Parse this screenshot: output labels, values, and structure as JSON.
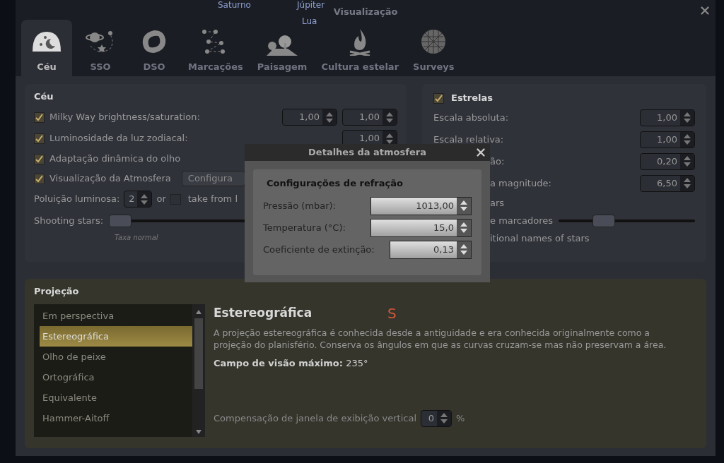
{
  "sky_labels": [
    {
      "text": "Saturno"
    },
    {
      "text": "Júpiter"
    },
    {
      "text": "Lua"
    }
  ],
  "window": {
    "title": "Visualização"
  },
  "tabs": [
    {
      "label": "Céu",
      "selected": true
    },
    {
      "label": "SSO",
      "selected": false
    },
    {
      "label": "DSO",
      "selected": false
    },
    {
      "label": "Marcações",
      "selected": false
    },
    {
      "label": "Paisagem",
      "selected": false
    },
    {
      "label": "Cultura estelar",
      "selected": false
    },
    {
      "label": "Surveys",
      "selected": false
    }
  ],
  "sky_group": {
    "title": "Céu",
    "rows": [
      {
        "kind": "check_spin",
        "label": "Milky Way brightness/saturation:",
        "checked": true,
        "values": [
          "1,00",
          "1,00"
        ]
      },
      {
        "kind": "check_spin",
        "label": "Luminosidade da luz zodiacal:",
        "checked": true,
        "values": [
          "1,00"
        ]
      },
      {
        "kind": "check",
        "label": "Adaptação dinâmica do olho",
        "checked": true
      },
      {
        "kind": "check_button",
        "label": "Visualização da Atmosfera",
        "checked": true,
        "button": "Configura"
      },
      {
        "kind": "pollution",
        "label": "Poluição luminosa:",
        "value": "2",
        "or": "or",
        "checked": false,
        "text": "take from l"
      },
      {
        "kind": "slider",
        "label": "Shooting stars:",
        "level": 0.0,
        "caption": "Taxa normal"
      }
    ]
  },
  "stars_group": {
    "title": "Estrelas",
    "checked": true,
    "rows": [
      {
        "kind": "spin",
        "label": "Escala absoluta:",
        "value": "1,00"
      },
      {
        "kind": "spin",
        "label": "Escala relativa:",
        "value": "1,00"
      },
      {
        "kind": "spin",
        "label": "ão:",
        "value": "0,20"
      },
      {
        "kind": "spin",
        "label": "a magnitude:",
        "value": "6,50"
      },
      {
        "kind": "text",
        "label": "ars"
      },
      {
        "kind": "slider",
        "label": "e marcadores",
        "level": 0.3
      },
      {
        "kind": "text",
        "label": "itional names of stars"
      }
    ]
  },
  "projection": {
    "title": "Projeção",
    "items": [
      {
        "label": "Em perspectiva",
        "selected": false
      },
      {
        "label": "Estereográfica",
        "selected": true
      },
      {
        "label": "Olho de peixe",
        "selected": false
      },
      {
        "label": "Ortográfica",
        "selected": false
      },
      {
        "label": "Equivalente",
        "selected": false
      },
      {
        "label": "Hammer-Aitoff",
        "selected": false
      }
    ],
    "heading": "Estereográfica",
    "cardinal": "S",
    "description": "A projeção estereográfica é conhecida desde a antiguidade e era conhecida originalmente como a projeção do planisfério. Conserva os ângulos em que as curvas cruzam-se mas não preservam a área.",
    "max_fov": "**Campo de visão máximo:** 235°",
    "offset_label": "Compensação de janela de exibição vertical",
    "offset_value": "0",
    "offset_unit": "%"
  },
  "atmosphere_dialog": {
    "title": "Detalhes da atmosfera",
    "group": "Configurações de refração",
    "rows": [
      {
        "label": "Pressão (mbar):",
        "value": "1013,00"
      },
      {
        "label": "Temperatura (°C):",
        "value": "15,0"
      },
      {
        "label": "Coeficiente de extinção:",
        "value": "0,13"
      }
    ]
  }
}
